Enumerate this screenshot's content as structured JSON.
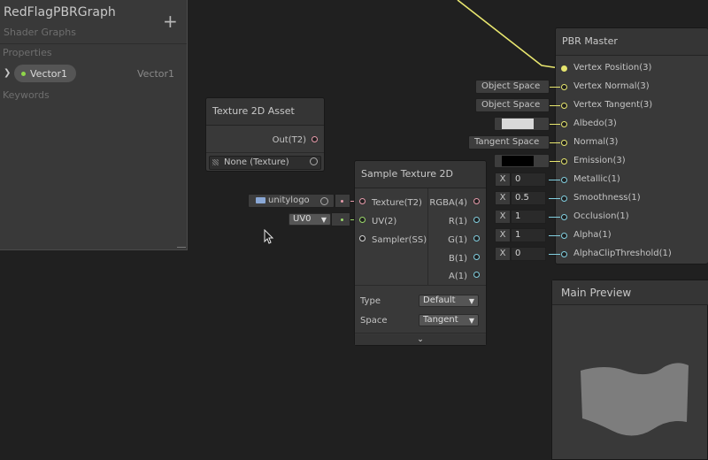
{
  "blackboard": {
    "title": "RedFlagPBRGraph",
    "subtitle": "Shader Graphs",
    "add_icon": "plus-icon",
    "properties_label": "Properties",
    "property": {
      "name": "Vector1",
      "type": "Vector1"
    },
    "keywords_label": "Keywords"
  },
  "texture_asset_node": {
    "title": "Texture 2D Asset",
    "output_label": "Out(T2)",
    "value": "None (Texture)"
  },
  "sample_node": {
    "title": "Sample Texture 2D",
    "inputs": [
      "Texture(T2)",
      "UV(2)",
      "Sampler(SS)"
    ],
    "outputs": [
      "RGBA(4)",
      "R(1)",
      "G(1)",
      "B(1)",
      "A(1)"
    ],
    "type_label": "Type",
    "type_value": "Default",
    "space_label": "Space",
    "space_value": "Tangent",
    "texture_input_value": "unitylogo",
    "uv_input_value": "UV0"
  },
  "master_node": {
    "title": "PBR Master",
    "slots": [
      "Vertex Position(3)",
      "Vertex Normal(3)",
      "Vertex Tangent(3)",
      "Albedo(3)",
      "Normal(3)",
      "Emission(3)",
      "Metallic(1)",
      "Smoothness(1)",
      "Occlusion(1)",
      "Alpha(1)",
      "AlphaClipThreshold(1)"
    ],
    "inputs": {
      "vertex_normal": "Object Space",
      "vertex_tangent": "Object Space",
      "normal": "Tangent Space",
      "albedo_color": "#d9d9d9",
      "emission_color": "#000000",
      "x_label": "X",
      "metallic": "0",
      "smoothness": "0.5",
      "occlusion": "1",
      "alpha": "1",
      "alpha_clip": "0"
    }
  },
  "preview": {
    "title": "Main Preview"
  },
  "colors": {
    "wire_yellow": "#e8e66e",
    "wire_green": "#9bd96a",
    "wire_pink": "#e79bab",
    "wire_cyan": "#82cfe0"
  }
}
